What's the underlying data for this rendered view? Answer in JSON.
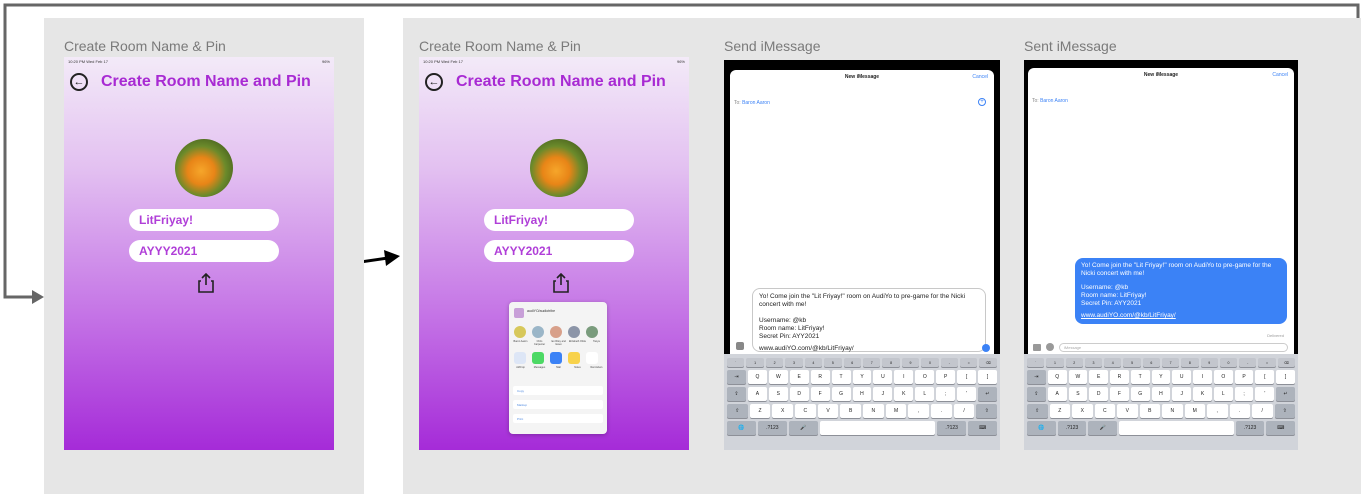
{
  "frames": [
    {
      "label": "Create Room Name & Pin"
    },
    {
      "label": "Create Room Name & Pin"
    },
    {
      "label": "Send iMessage"
    },
    {
      "label": "Sent iMessage"
    }
  ],
  "status_bar": {
    "time1": "10:20 PM  Wed Feb 17",
    "time2": "10:20 PM  Wed Feb 17",
    "battery": "96%"
  },
  "create_screen": {
    "title": "Create Room Name and Pin",
    "room_name": "LitFriyay!",
    "room_pin": "AYYY2021"
  },
  "share_sheet": {
    "app_name": "audiYO/audiotribe",
    "contacts": [
      "Baron Aaron",
      "Chris Carpenter",
      "Ian Riley and Gwen",
      "Elizabeth Ofole",
      "Tanya"
    ],
    "apps": [
      "AirDrop",
      "Messages",
      "Mail",
      "Notes",
      "Reminders"
    ],
    "actions": [
      "Copy",
      "Markup",
      "Print"
    ]
  },
  "send_message": {
    "header": "New iMessage",
    "cancel": "Cancel",
    "to_label": "To:",
    "recipient": "Baron Aaron",
    "body_line1": "Yo! Come join the \"Lit Friyay!\" room on AudiYo to pre-game for the Nicki concert with me!",
    "username": "Username: @kb",
    "room_name": "Room name: LitFriyay!",
    "secret_pin": "Secret Pin: AYY2021",
    "link": "www.audiYO.com/@kb/LitFriyay/"
  },
  "sent_message": {
    "header": "New iMessage",
    "cancel": "Cancel",
    "to_label": "To:",
    "recipient": "Baron Aaron",
    "delivered": "Delivered",
    "imessage_placeholder": "iMessage",
    "link": "www.audiYO.com/@kb/LitFriyay/"
  },
  "keyboard": {
    "numbers": [
      "`",
      "1",
      "2",
      "3",
      "4",
      "5",
      "6",
      "7",
      "8",
      "9",
      "0",
      "-",
      "=",
      "⌫"
    ],
    "row1": [
      "⇥",
      "Q",
      "W",
      "E",
      "R",
      "T",
      "Y",
      "U",
      "I",
      "O",
      "P",
      "[",
      "]"
    ],
    "row2": [
      "⇪",
      "A",
      "S",
      "D",
      "F",
      "G",
      "H",
      "J",
      "K",
      "L",
      ";",
      "'",
      "↵"
    ],
    "row3": [
      "⇧",
      "Z",
      "X",
      "C",
      "V",
      "B",
      "N",
      "M",
      ",",
      ".",
      "/",
      "⇧"
    ],
    "row4": [
      "🌐",
      ".?123",
      "🎤",
      "",
      ".?123",
      "⌨"
    ]
  },
  "colors": {
    "accent_purple": "#a82ad3",
    "imessage_blue": "#3b82f6",
    "flow_arrow": "#000000",
    "loop_line": "#666666"
  }
}
